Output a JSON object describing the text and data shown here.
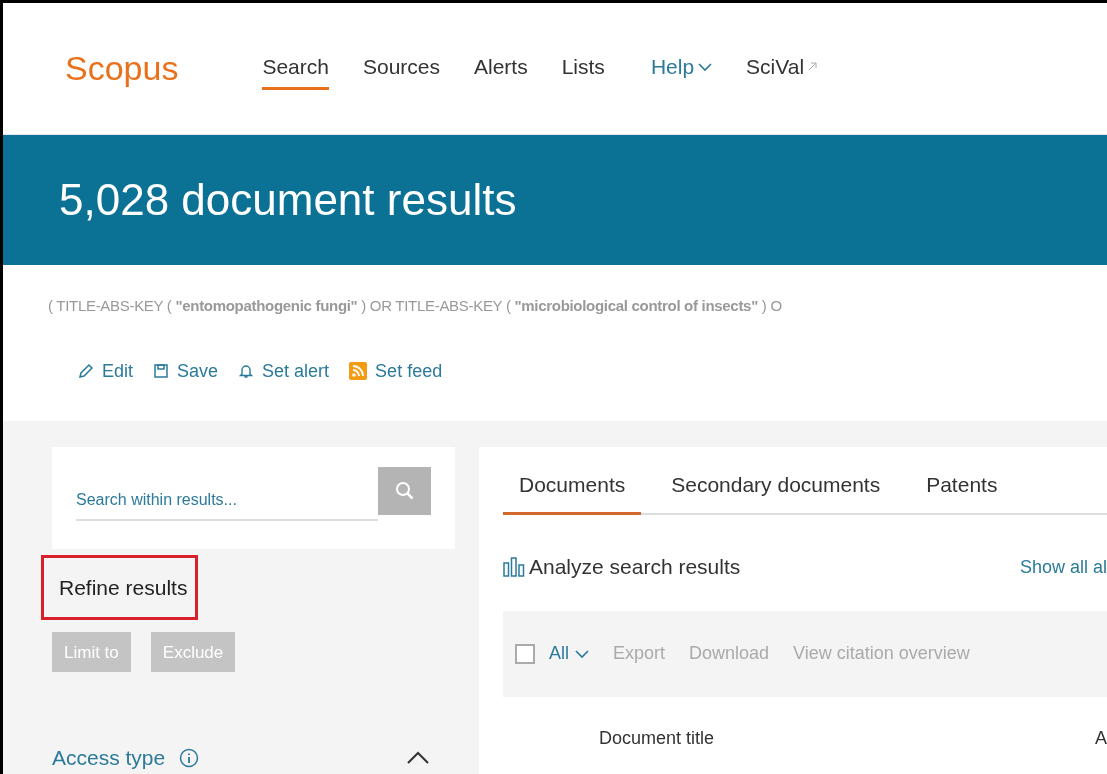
{
  "header": {
    "logo": "Scopus",
    "nav": [
      {
        "label": "Search",
        "selected": true,
        "kind": "plain"
      },
      {
        "label": "Sources",
        "selected": false,
        "kind": "plain"
      },
      {
        "label": "Alerts",
        "selected": false,
        "kind": "plain"
      },
      {
        "label": "Lists",
        "selected": false,
        "kind": "plain"
      },
      {
        "label": "Help",
        "selected": false,
        "kind": "dropdown"
      },
      {
        "label": "SciVal",
        "selected": false,
        "kind": "external"
      }
    ]
  },
  "banner": {
    "title": "5,028 document results"
  },
  "query": "( TITLE-ABS-KEY ( **\"entomopathogenic fungi\"** )  OR  TITLE-ABS-KEY ( **\"microbiological control of insects\"** )  O",
  "query_actions": [
    {
      "label": "Edit",
      "kind": "edit"
    },
    {
      "label": "Save",
      "kind": "save"
    },
    {
      "label": "Set alert",
      "kind": "alert"
    },
    {
      "label": "Set feed",
      "kind": "feed"
    }
  ],
  "sidebar": {
    "search": {
      "placeholder": "Search within results..."
    },
    "refine": {
      "title": "Refine results",
      "highlighted": true
    },
    "buttons": [
      {
        "label": "Limit to",
        "disabled": true
      },
      {
        "label": "Exclude",
        "disabled": true
      }
    ],
    "facet": {
      "title": "Access type",
      "expanded": true
    }
  },
  "results": {
    "tabs": [
      {
        "label": "Documents",
        "selected": true
      },
      {
        "label": "Secondary documents",
        "selected": false
      },
      {
        "label": "Patents",
        "selected": false
      }
    ],
    "analyze": "Analyze search results",
    "show_all": "Show all al",
    "toolbar": {
      "select_all": {
        "label": "All",
        "checked": false
      },
      "actions": [
        "Export",
        "Download",
        "View citation overview"
      ]
    },
    "columns": [
      "Document title",
      "A"
    ]
  }
}
